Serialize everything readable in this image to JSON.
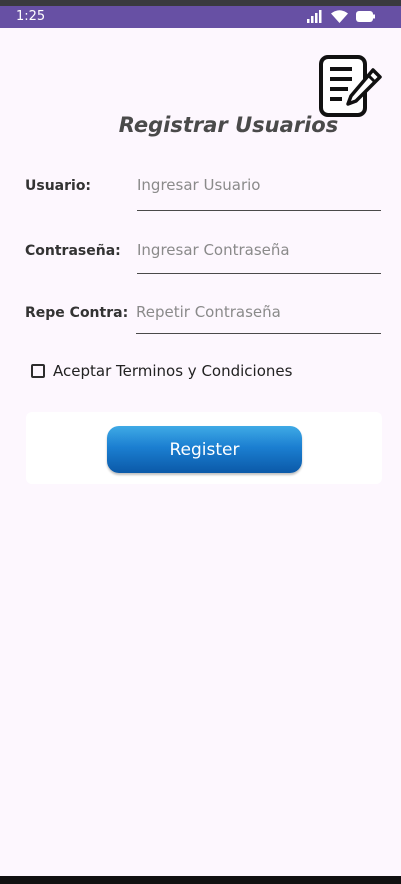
{
  "status_bar": {
    "time": "1:25"
  },
  "title": "Registrar Usuarios",
  "form": {
    "usuario": {
      "label": "Usuario:",
      "placeholder": "Ingresar Usuario",
      "value": ""
    },
    "contrasena": {
      "label": "Contraseña:",
      "placeholder": "Ingresar Contraseña",
      "value": ""
    },
    "repetir": {
      "label": "Repe Contra:",
      "placeholder": "Repetir Contraseña",
      "value": ""
    }
  },
  "terms": {
    "label": "Aceptar Terminos y Condiciones",
    "checked": false
  },
  "register_button": {
    "label": "Register"
  },
  "colors": {
    "status_bar": "#6750a4",
    "background": "#fdf7fe",
    "button": "#1b7fd1"
  }
}
